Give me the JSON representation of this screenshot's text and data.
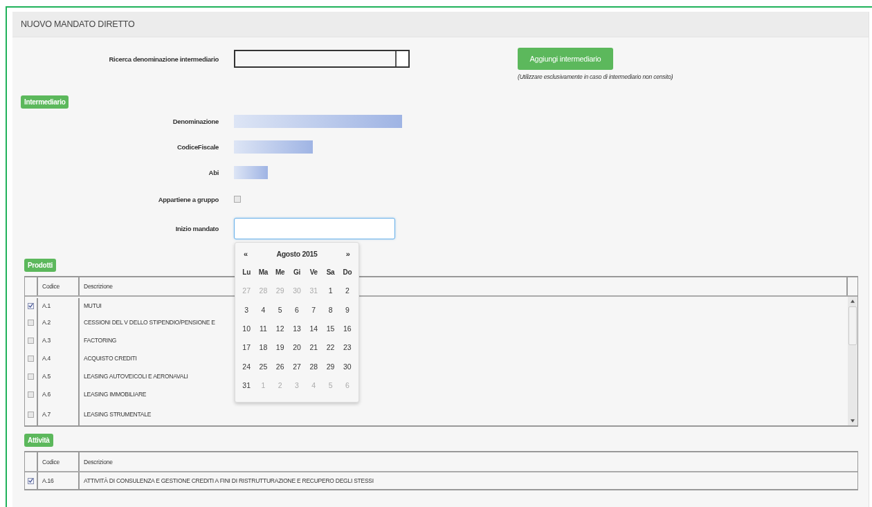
{
  "panel": {
    "title": "NUOVO MANDATO DIRETTO"
  },
  "search": {
    "label": "Ricerca denominazione intermediario"
  },
  "add_button": {
    "label": "Aggiungi intermediario",
    "note": "(Utilizzare esclusivamente in caso di intermediario non censito)"
  },
  "intermediario": {
    "badge": "Intermediario",
    "fields": [
      {
        "label": "Denominazione",
        "kind": "redacted"
      },
      {
        "label": "CodiceFiscale",
        "kind": "redacted"
      },
      {
        "label": "Abi",
        "kind": "redacted"
      },
      {
        "label": "Appartiene a gruppo",
        "kind": "checkbox",
        "checked": false
      },
      {
        "label": "Inizio mandato",
        "kind": "date",
        "focused": true
      }
    ]
  },
  "datepicker": {
    "prev": "«",
    "title": "Agosto 2015",
    "next": "»",
    "weekdays": [
      "Lu",
      "Ma",
      "Me",
      "Gi",
      "Ve",
      "Sa",
      "Do"
    ],
    "weeks": [
      [
        {
          "day": "27",
          "other_month": true
        },
        {
          "day": "28",
          "other_month": true
        },
        {
          "day": "29",
          "other_month": true
        },
        {
          "day": "30",
          "other_month": true
        },
        {
          "day": "31",
          "other_month": true
        },
        {
          "day": "1",
          "other_month": false
        },
        {
          "day": "2",
          "other_month": false
        }
      ],
      [
        {
          "day": "3",
          "other_month": false
        },
        {
          "day": "4",
          "other_month": false
        },
        {
          "day": "5",
          "other_month": false
        },
        {
          "day": "6",
          "other_month": false
        },
        {
          "day": "7",
          "other_month": false
        },
        {
          "day": "8",
          "other_month": false
        },
        {
          "day": "9",
          "other_month": false
        }
      ],
      [
        {
          "day": "10",
          "other_month": false
        },
        {
          "day": "11",
          "other_month": false
        },
        {
          "day": "12",
          "other_month": false
        },
        {
          "day": "13",
          "other_month": false
        },
        {
          "day": "14",
          "other_month": false
        },
        {
          "day": "15",
          "other_month": false
        },
        {
          "day": "16",
          "other_month": false
        }
      ],
      [
        {
          "day": "17",
          "other_month": false
        },
        {
          "day": "18",
          "other_month": false
        },
        {
          "day": "19",
          "other_month": false
        },
        {
          "day": "20",
          "other_month": false
        },
        {
          "day": "21",
          "other_month": false
        },
        {
          "day": "22",
          "other_month": false
        },
        {
          "day": "23",
          "other_month": false
        }
      ],
      [
        {
          "day": "24",
          "other_month": false
        },
        {
          "day": "25",
          "other_month": false
        },
        {
          "day": "26",
          "other_month": false
        },
        {
          "day": "27",
          "other_month": false
        },
        {
          "day": "28",
          "other_month": false
        },
        {
          "day": "29",
          "other_month": false
        },
        {
          "day": "30",
          "other_month": false
        }
      ],
      [
        {
          "day": "31",
          "other_month": false
        },
        {
          "day": "1",
          "other_month": true
        },
        {
          "day": "2",
          "other_month": true
        },
        {
          "day": "3",
          "other_month": true
        },
        {
          "day": "4",
          "other_month": true
        },
        {
          "day": "5",
          "other_month": true
        },
        {
          "day": "6",
          "other_month": true
        }
      ]
    ]
  },
  "prodotti": {
    "badge": "Prodotti",
    "columns": [
      "Codice",
      "Descrizione"
    ],
    "rows": [
      {
        "checked": true,
        "code": "A.1",
        "description": "MUTUI"
      },
      {
        "checked": false,
        "code": "A.2",
        "description": "CESSIONI DEL V DELLO STIPENDIO/PENSIONE E"
      },
      {
        "checked": false,
        "code": "A.3",
        "description": "FACTORING"
      },
      {
        "checked": false,
        "code": "A.4",
        "description": "ACQUISTO CREDITI"
      },
      {
        "checked": false,
        "code": "A.5",
        "description": "LEASING AUTOVEICOLI E AERONAVALI"
      },
      {
        "checked": false,
        "code": "A.6",
        "description": "LEASING IMMOBILIARE"
      },
      {
        "checked": false,
        "code": "A.7",
        "description": "LEASING STRUMENTALE"
      }
    ]
  },
  "attivita": {
    "badge": "Attività",
    "columns": [
      "Codice",
      "Descrizione"
    ],
    "rows": [
      {
        "checked": true,
        "code": "A.16",
        "description": "ATTIVITÀ DI CONSULENZA E GESTIONE CREDITI A FINI DI RISTRUTTURAZIONE E RECUPERO DEGLI STESSI"
      }
    ]
  }
}
